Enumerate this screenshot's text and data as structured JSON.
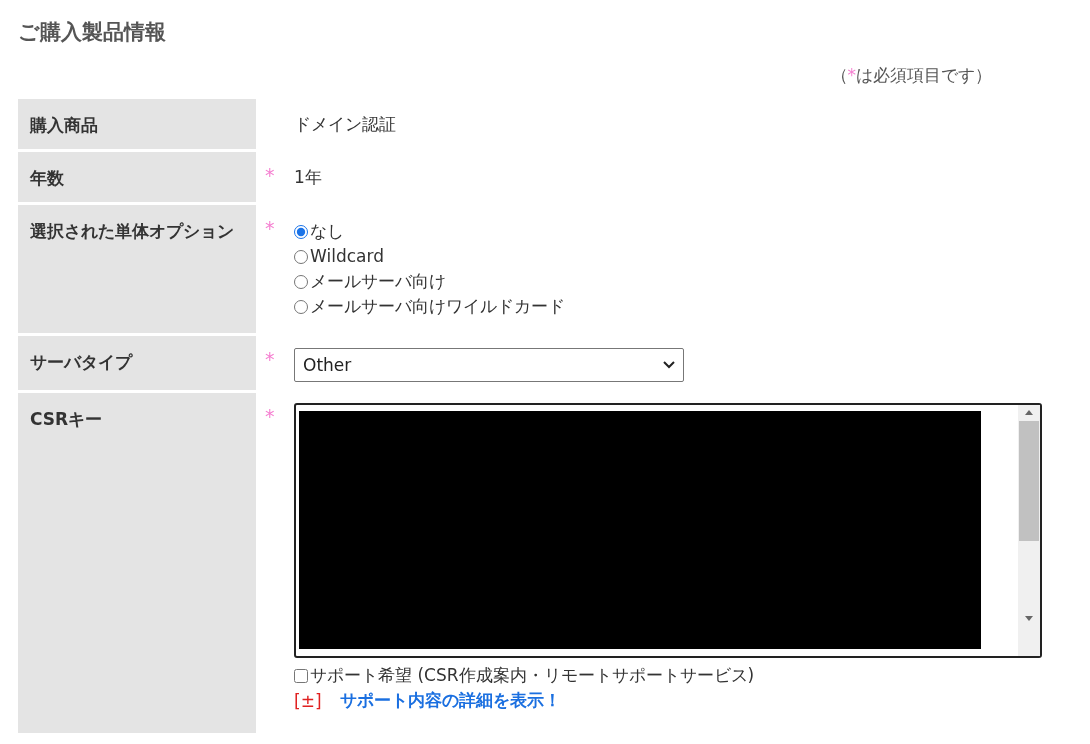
{
  "page_title": "ご購入製品情報",
  "required_note": {
    "open": "（",
    "mark": "*",
    "text": "は必須項目です）"
  },
  "required_mark": "*",
  "rows": [
    {
      "kind": "text",
      "label": "購入商品",
      "required": false,
      "value": "ドメイン認証"
    },
    {
      "kind": "text",
      "label": "年数",
      "required": true,
      "value": "1年"
    },
    {
      "kind": "radio",
      "label": "選択された単体オプション",
      "required": true,
      "options": [
        {
          "label": "なし",
          "selected": true
        },
        {
          "label": "Wildcard",
          "selected": false
        },
        {
          "label": "メールサーバ向け",
          "selected": false
        },
        {
          "label": "メールサーバ向けワイルドカード",
          "selected": false
        }
      ]
    },
    {
      "kind": "select",
      "label": "サーバタイプ",
      "required": true,
      "value": "Other"
    },
    {
      "kind": "csr",
      "label": "CSRキー",
      "required": true,
      "redacted": true,
      "support": {
        "label": "サポート希望 (CSR作成案内・リモートサポートサービス)",
        "checked": false
      },
      "toggle": "[±]",
      "link": "サポート内容の詳細を表示！"
    }
  ]
}
